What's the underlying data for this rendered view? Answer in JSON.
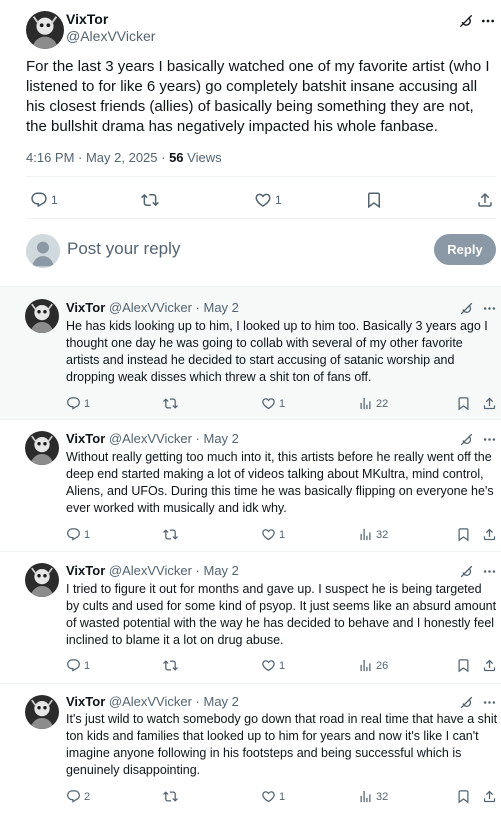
{
  "main_tweet": {
    "name": "VixTor",
    "handle": "@AlexVVicker",
    "text": "For the last 3 years I basically watched one of my favorite artist (who I listened to for like 6 years) go completely batshit insane accusing all his closest friends (allies) of basically being something they are not, the bullshit drama has negatively impacted his whole fanbase.",
    "timestamp": "4:16 PM · May 2, 2025 · ",
    "views_count": "56",
    "views_label": " Views",
    "reply_count": "1",
    "like_count": "1"
  },
  "compose": {
    "placeholder": "Post your reply",
    "button_label": "Reply"
  },
  "replies": [
    {
      "name": "VixTor",
      "meta": "@AlexVVicker · May 2",
      "text": "He has kids looking up to him, I looked up to him too. Basically 3 years ago I thought one day he was going to collab with several of my other favorite artists and instead he decided to start accusing of satanic worship and dropping weak disses which threw a shit ton of fans off.",
      "replies": "1",
      "likes": "1",
      "views": "22"
    },
    {
      "name": "VixTor",
      "meta": "@AlexVVicker · May 2",
      "text": "Without really getting too much into it, this artists before he really went off the deep end started making a lot of videos talking about MKultra, mind control, Aliens, and UFOs. During this time he was basically flipping on everyone he's ever worked with musically and idk why.",
      "replies": "1",
      "likes": "1",
      "views": "32"
    },
    {
      "name": "VixTor",
      "meta": "@AlexVVicker · May 2",
      "text": "I tried to figure it out for months and gave up. I suspect he is being targeted by cults and used for some kind of psyop. It just seems like an absurd amount of wasted potential with the way he has decided to behave and I honestly feel inclined to blame it a lot on drug abuse.",
      "replies": "1",
      "likes": "1",
      "views": "26"
    },
    {
      "name": "VixTor",
      "meta": "@AlexVVicker · May 2",
      "text": "It's just wild to watch somebody go down that road in real time that have a shit ton kids and families that looked up to him for years and now it's like I can't imagine anyone following in his footsteps and being successful which is genuinely disappointing.",
      "replies": "2",
      "likes": "1",
      "views": "32"
    }
  ],
  "icons": {
    "reply": "reply-icon",
    "repost": "repost-icon",
    "like": "heart-icon",
    "views": "views-icon",
    "bookmark": "bookmark-icon",
    "share": "share-icon",
    "grok": "grok-icon",
    "more": "more-icon"
  },
  "colors": {
    "text": "#0f1419",
    "secondary": "#536471",
    "divider": "#eff3f4",
    "reply_button": "#8b98a5",
    "highlight": "#f7f9f9"
  }
}
